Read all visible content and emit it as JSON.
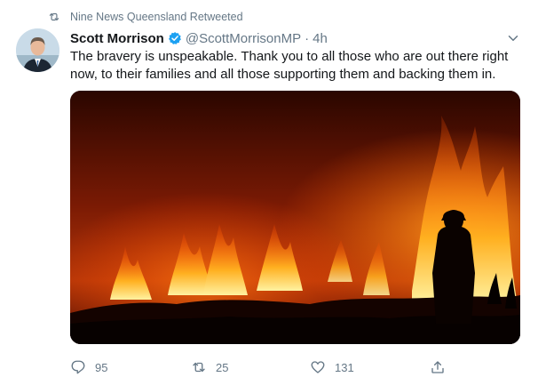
{
  "retweet_context": {
    "text": "Nine News Queensland Retweeted",
    "icon": "retweet-icon"
  },
  "author": {
    "name": "Scott Morrison",
    "verified": true,
    "handle": "@ScottMorrisonMP",
    "separator": "·",
    "time": "4h",
    "avatar": "avatar-image"
  },
  "tweet": {
    "text": "The bravery is unspeakable. Thank you to all those who are out there right now, to their families and all those supporting them and backing them in."
  },
  "media": {
    "subject": "firefighter silhouette in front of bushfire"
  },
  "actions": {
    "reply_count": "95",
    "retweet_count": "25",
    "like_count": "131"
  },
  "colors": {
    "text": "#14171a",
    "secondary": "#657786",
    "verified": "#1da1f2"
  }
}
